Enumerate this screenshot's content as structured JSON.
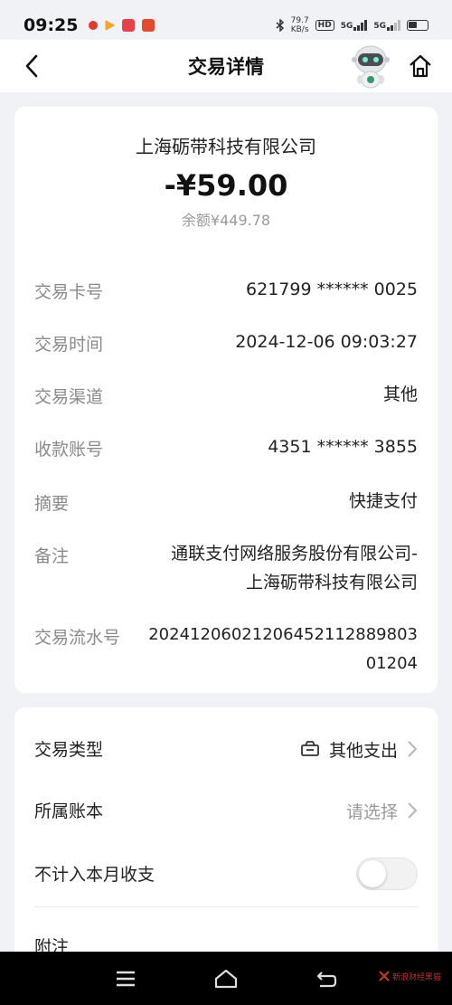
{
  "status_bar": {
    "time": "09:25",
    "net_speed_value": "79.7",
    "net_speed_unit": "KB/s",
    "hd_badge": "HD",
    "network_1": "5G",
    "network_2": "5G"
  },
  "header": {
    "title": "交易详情"
  },
  "transaction": {
    "merchant": "上海砺带科技有限公司",
    "amount": "-¥59.00",
    "balance": "余额¥449.78",
    "details": [
      {
        "label": "交易卡号",
        "value": "621799 ****** 0025"
      },
      {
        "label": "交易时间",
        "value": "2024-12-06 09:03:27"
      },
      {
        "label": "交易渠道",
        "value": "其他"
      },
      {
        "label": "收款账号",
        "value": "4351 ****** 3855"
      },
      {
        "label": "摘要",
        "value": "快捷支付"
      },
      {
        "label": "备注",
        "value_line1": "通联支付网络服务股份有限公司-",
        "value_line2": "上海砺带科技有限公司"
      },
      {
        "label": "交易流水号",
        "value_line1": "20241206021206452112889803",
        "value_line2": "01204"
      }
    ]
  },
  "settings": {
    "type_label": "交易类型",
    "type_value": "其他支出",
    "book_label": "所属账本",
    "book_value": "请选择",
    "exclude_label": "不计入本月收支",
    "exclude_enabled": false,
    "note_label": "附注"
  },
  "nav": {
    "watermark": "新浪财经黑猫"
  },
  "colors": {
    "background": "#f1f2f5",
    "card": "#ffffff",
    "label_gray": "#8a8a8a",
    "nav_bar": "#000000"
  }
}
